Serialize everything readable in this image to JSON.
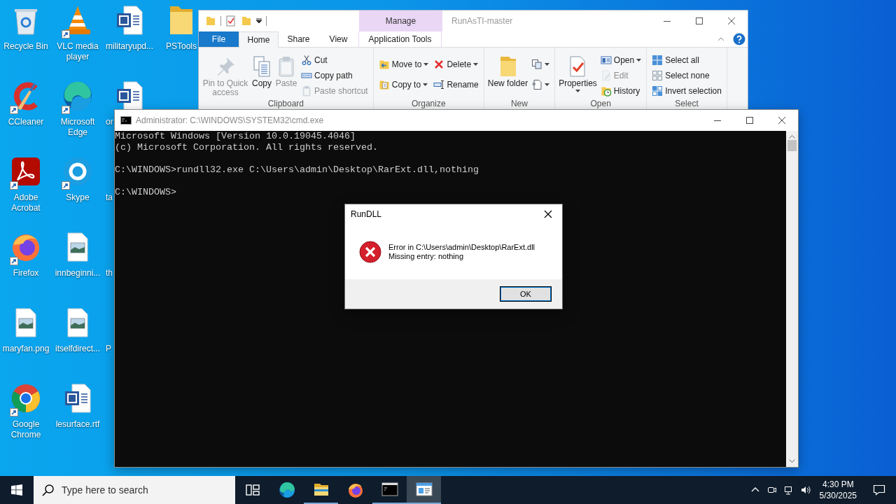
{
  "desktop": {
    "columns": [
      [
        {
          "label": "Recycle Bin",
          "kind": "recycle",
          "shortcut": false
        },
        {
          "label": "CCleaner",
          "kind": "ccleaner",
          "shortcut": true
        },
        {
          "label": "Adobe Acrobat",
          "kind": "acrobat",
          "shortcut": true
        },
        {
          "label": "Firefox",
          "kind": "firefox",
          "shortcut": true
        },
        {
          "label": "maryfan.png",
          "kind": "image",
          "shortcut": false
        },
        {
          "label": "Google Chrome",
          "kind": "chrome",
          "shortcut": true
        }
      ],
      [
        {
          "label": "VLC media player",
          "kind": "vlc",
          "shortcut": true
        },
        {
          "label": "Microsoft Edge",
          "kind": "edge",
          "shortcut": true
        },
        {
          "label": "Skype",
          "kind": "skype",
          "shortcut": true
        },
        {
          "label": "innbeginni...",
          "kind": "image",
          "shortcut": false
        },
        {
          "label": "itselfdirect...",
          "kind": "image",
          "shortcut": false
        },
        {
          "label": "lesurface.rtf",
          "kind": "word",
          "shortcut": false
        }
      ],
      [
        {
          "label": "militaryupd...",
          "kind": "word",
          "shortcut": false
        },
        {
          "label": "or",
          "kind": "word",
          "shortcut": false
        },
        {
          "label": "ta"
        },
        {
          "label": "th"
        },
        {
          "label": "P"
        }
      ],
      [
        {
          "label": "PSTools",
          "kind": "folder",
          "shortcut": false
        }
      ]
    ]
  },
  "explorer": {
    "title": "RunAsTI-master",
    "context_group": "Manage",
    "tabs": [
      {
        "label": "File",
        "kind": "file",
        "selected": false
      },
      {
        "label": "Home",
        "kind": "tab",
        "selected": true
      },
      {
        "label": "Share",
        "kind": "tab",
        "selected": false
      },
      {
        "label": "View",
        "kind": "tab",
        "selected": false
      },
      {
        "label": "Application Tools",
        "kind": "context",
        "selected": false
      }
    ],
    "ribbon": [
      {
        "label": "Clipboard",
        "columns": [
          {
            "kind": "large",
            "items": [
              {
                "label": "Pin to Quick access",
                "disabled": true,
                "dropdown": false
              }
            ]
          },
          {
            "kind": "large",
            "items": [
              {
                "label": "Copy",
                "disabled": false,
                "dropdown": false
              }
            ]
          },
          {
            "kind": "large",
            "items": [
              {
                "label": "Paste",
                "disabled": true,
                "dropdown": false
              }
            ]
          },
          {
            "kind": "small",
            "items": [
              {
                "label": "Cut",
                "disabled": false,
                "dropdown": false
              },
              {
                "label": "Copy path",
                "disabled": false,
                "dropdown": false
              },
              {
                "label": "Paste shortcut",
                "disabled": true,
                "dropdown": false
              }
            ]
          }
        ]
      },
      {
        "label": "Organize",
        "columns": [
          {
            "kind": "small",
            "items": [
              {
                "label": "Move to",
                "disabled": false,
                "dropdown": true
              },
              {
                "label": "Copy to",
                "disabled": false,
                "dropdown": true
              }
            ]
          },
          {
            "kind": "small",
            "items": [
              {
                "label": "Delete",
                "disabled": false,
                "dropdown": true
              },
              {
                "label": "Rename",
                "disabled": false,
                "dropdown": false
              }
            ]
          }
        ]
      },
      {
        "label": "New",
        "columns": [
          {
            "kind": "large",
            "items": [
              {
                "label": "New folder",
                "disabled": false,
                "dropdown": false
              }
            ]
          },
          {
            "kind": "small",
            "items": [
              {
                "disabled": false,
                "dropdown": true
              },
              {
                "disabled": false,
                "dropdown": true
              }
            ]
          }
        ]
      },
      {
        "label": "Open",
        "columns": [
          {
            "kind": "large",
            "items": [
              {
                "label": "Properties",
                "disabled": false,
                "dropdown": true
              }
            ]
          },
          {
            "kind": "small",
            "items": [
              {
                "label": "Open",
                "disabled": false,
                "dropdown": true
              },
              {
                "label": "Edit",
                "disabled": true,
                "dropdown": false
              },
              {
                "label": "History",
                "disabled": false,
                "dropdown": false
              }
            ]
          }
        ]
      },
      {
        "label": "Select",
        "columns": [
          {
            "kind": "small",
            "items": [
              {
                "label": "Select all",
                "disabled": false,
                "dropdown": false
              },
              {
                "label": "Select none",
                "disabled": false,
                "dropdown": false
              },
              {
                "label": "Invert selection",
                "disabled": false,
                "dropdown": false
              }
            ]
          }
        ]
      }
    ]
  },
  "console": {
    "title": "Administrator: C:\\WINDOWS\\SYSTEM32\\cmd.exe",
    "blocks": [
      [
        "Microsoft Windows [Version 10.0.19045.4046]",
        "(c) Microsoft Corporation. All rights reserved."
      ],
      [
        "C:\\WINDOWS>rundll32.exe C:\\Users\\admin\\Desktop\\RarExt.dll,nothing"
      ],
      [
        "C:\\WINDOWS>"
      ]
    ]
  },
  "dialog": {
    "title": "RunDLL",
    "message": [
      "Error in C:\\Users\\admin\\Desktop\\RarExt.dll",
      "Missing entry: nothing"
    ],
    "button": "OK"
  },
  "taskbar": {
    "search": {
      "placeholder": "Type here to search"
    },
    "apps": [
      {
        "kind": "taskview",
        "running": false,
        "selected": false
      },
      {
        "kind": "edge",
        "running": false,
        "selected": false
      },
      {
        "kind": "explorer",
        "running": true,
        "selected": false
      },
      {
        "kind": "firefox",
        "running": false,
        "selected": false
      },
      {
        "kind": "console",
        "running": true,
        "selected": false
      },
      {
        "kind": "dialog",
        "running": true,
        "selected": true
      }
    ],
    "time": "4:30 PM",
    "date": "5/30/2025"
  }
}
